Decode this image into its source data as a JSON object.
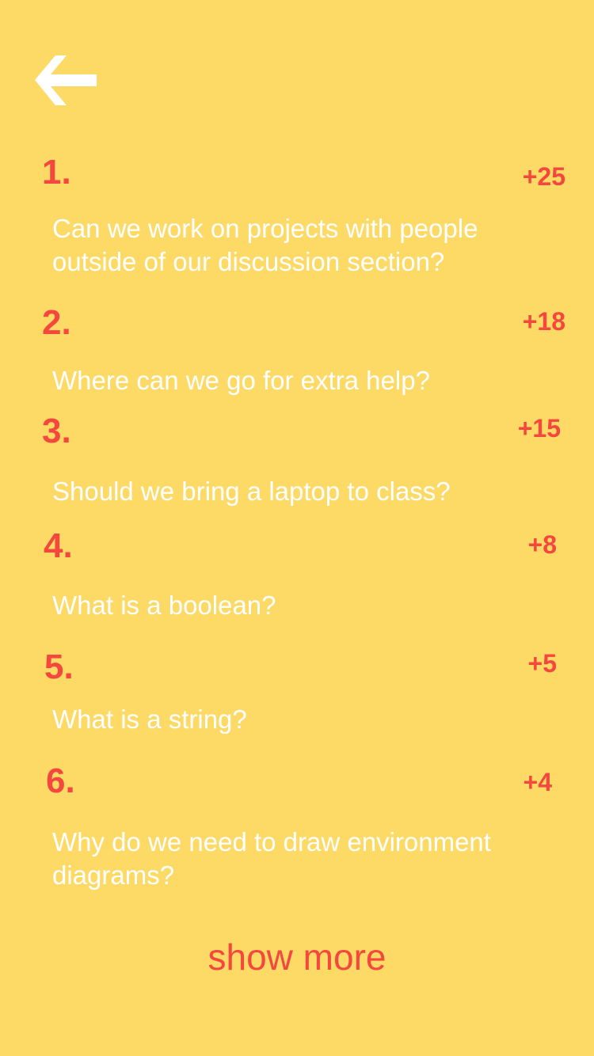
{
  "colors": {
    "background": "#FDD966",
    "accent": "#F4483E",
    "text": "#FFFFFF"
  },
  "nav": {
    "back_icon": "arrow-left-icon"
  },
  "questions": [
    {
      "rank": "1.",
      "score": "+25",
      "text": "Can we work on projects with people outside of our discussion section?"
    },
    {
      "rank": "2.",
      "score": "+18",
      "text": "Where can we go for extra help?"
    },
    {
      "rank": "3.",
      "score": "+15",
      "text": "Should we bring a laptop to class?"
    },
    {
      "rank": "4.",
      "score": "+8",
      "text": "What is a boolean?"
    },
    {
      "rank": "5.",
      "score": "+5",
      "text": "What is a string?"
    },
    {
      "rank": "6.",
      "score": "+4",
      "text": "Why do we need to draw environment diagrams?"
    }
  ],
  "show_more_label": "show more"
}
